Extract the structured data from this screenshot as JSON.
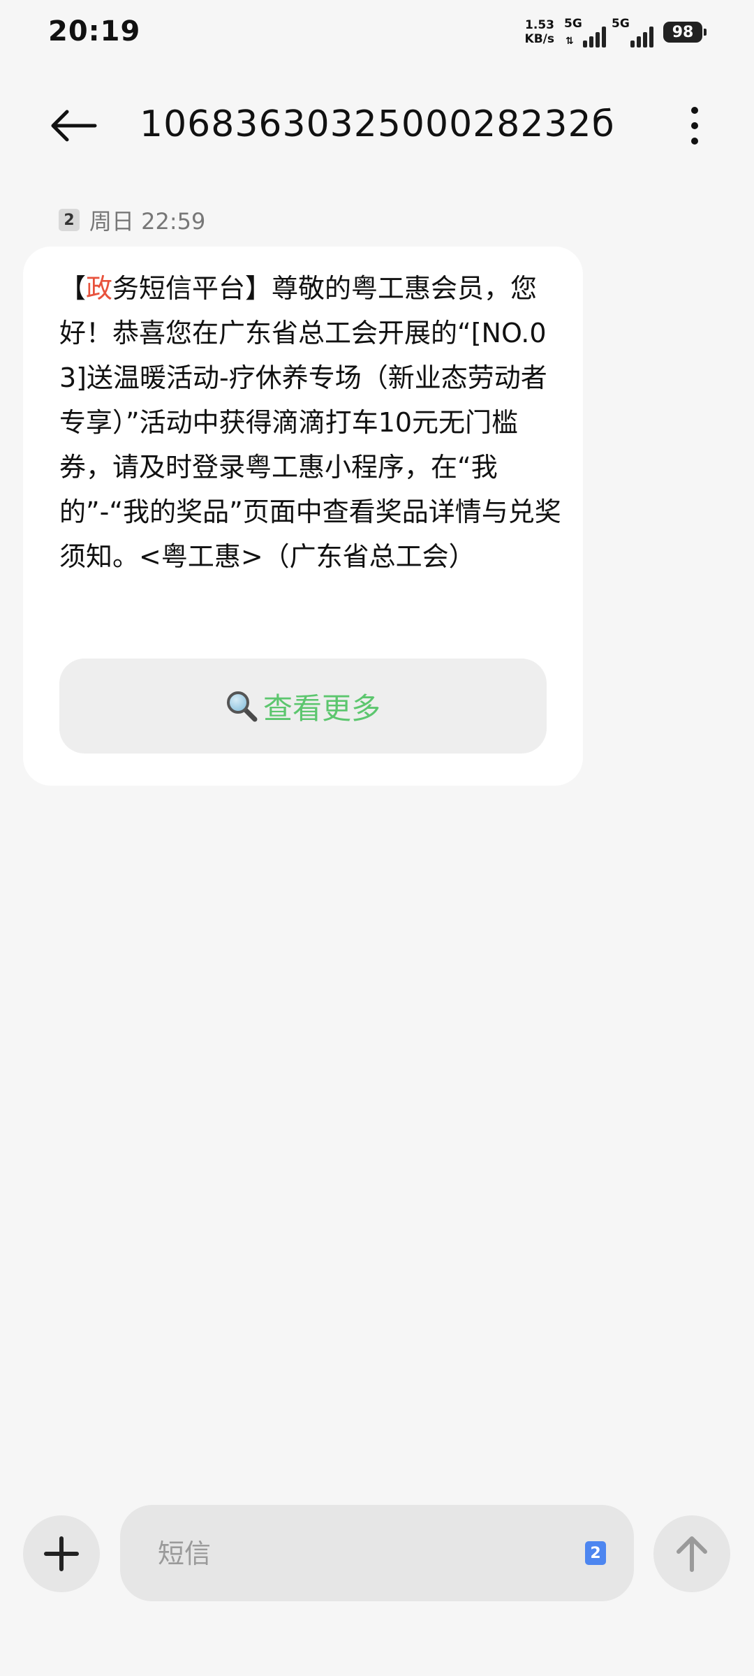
{
  "status_bar": {
    "time": "20:19",
    "net_speed_value": "1.53",
    "net_speed_unit": "KB/s",
    "sim1_label": "5G",
    "sim2_label": "5G",
    "battery": "98"
  },
  "header": {
    "title": "1068363032500028232б",
    "back_icon": "arrow-left-icon",
    "more_icon": "more-vertical-icon"
  },
  "message": {
    "sim_number": "2",
    "timestamp": "周日 22:59",
    "bracket_open": "【",
    "highlight": "政",
    "body": "务短信平台】尊敬的粤工惠会员，您好！恭喜您在广东省总工会开展的“[NO.03]送温暖活动-疗休养专场（新业态劳动者专享）”活动中获得滴滴打车10元无门槛券，请及时登录粤工惠小程序，在“我的”-“我的奖品”页面中查看奖品详情与兑奖须知。<粤工惠>（广东省总工会）",
    "link_label": "查看更多",
    "link_icon": "magnifier-icon",
    "highlight_color": "#e8523c",
    "link_color": "#5cc66e"
  },
  "composer": {
    "placeholder": "短信",
    "sim_number": "2",
    "add_icon": "plus-icon",
    "send_icon": "arrow-up-icon",
    "sim_color": "#4d86f0"
  }
}
